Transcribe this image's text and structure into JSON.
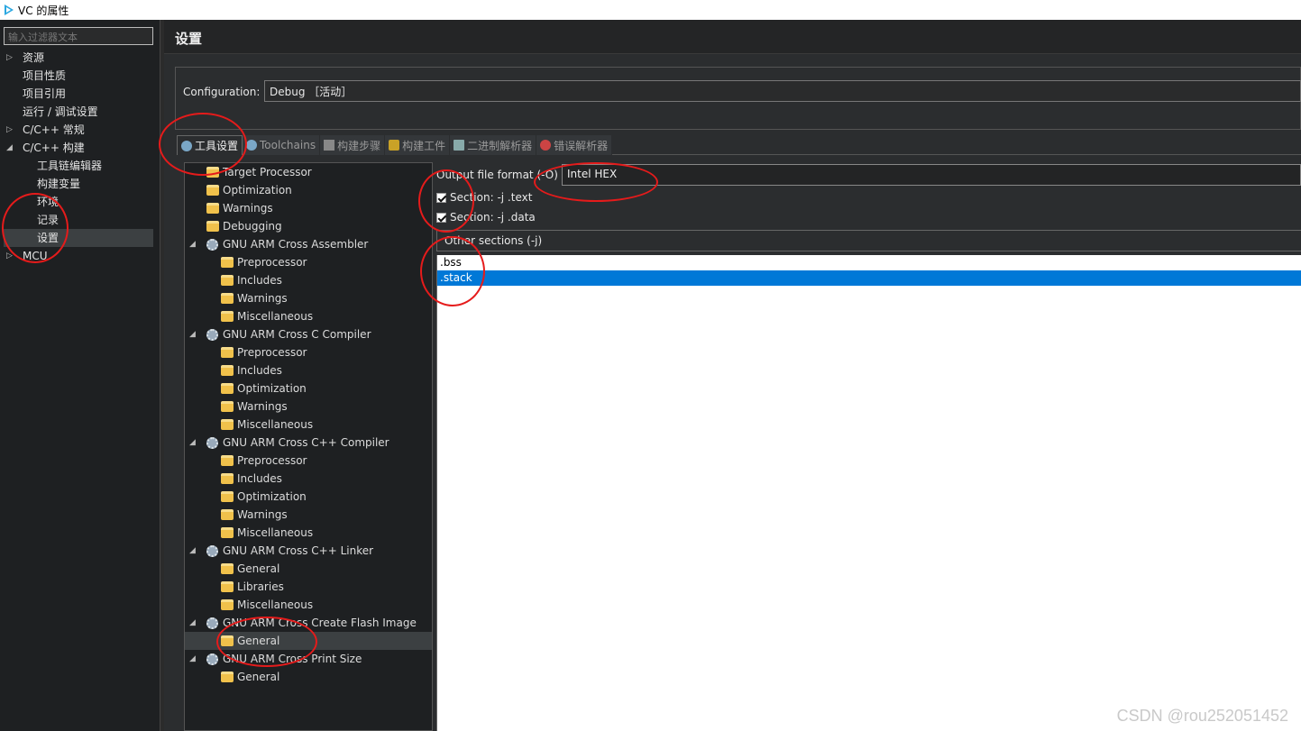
{
  "window": {
    "title": "VC 的属性"
  },
  "filter": {
    "placeholder": "输入过滤器文本"
  },
  "nav": [
    {
      "label": "资源",
      "expand": "▷"
    },
    {
      "label": "项目性质",
      "expand": ""
    },
    {
      "label": "项目引用",
      "expand": ""
    },
    {
      "label": "运行 / 调试设置",
      "expand": ""
    },
    {
      "label": "C/C++ 常规",
      "expand": "▷"
    },
    {
      "label": "C/C++ 构建",
      "expand": "◢"
    },
    {
      "label": "工具链编辑器",
      "expand": ""
    },
    {
      "label": "构建变量",
      "expand": ""
    },
    {
      "label": "环境",
      "expand": ""
    },
    {
      "label": "记录",
      "expand": ""
    },
    {
      "label": "设置",
      "expand": ""
    },
    {
      "label": "MCU",
      "expand": "▷"
    }
  ],
  "page": {
    "title": "设置"
  },
  "config": {
    "label": "Configuration:",
    "value": "Debug ［活动］"
  },
  "tabs": [
    {
      "label": "工具设置",
      "icon": "gear-icon"
    },
    {
      "label": "Toolchains",
      "icon": "gear-icon"
    },
    {
      "label": "构建步骤",
      "icon": "hammer-icon"
    },
    {
      "label": "构建工件",
      "icon": "trophy-icon"
    },
    {
      "label": "二进制解析器",
      "icon": "disk-icon"
    },
    {
      "label": "错误解析器",
      "icon": "bug-icon"
    }
  ],
  "tree": [
    {
      "label": "Target Processor",
      "tri": ""
    },
    {
      "label": "Optimization",
      "tri": ""
    },
    {
      "label": "Warnings",
      "tri": ""
    },
    {
      "label": "Debugging",
      "tri": ""
    },
    {
      "label": "GNU ARM Cross Assembler",
      "tri": "◢"
    },
    {
      "label": "Preprocessor",
      "tri": ""
    },
    {
      "label": "Includes",
      "tri": ""
    },
    {
      "label": "Warnings",
      "tri": ""
    },
    {
      "label": "Miscellaneous",
      "tri": ""
    },
    {
      "label": "GNU ARM Cross C Compiler",
      "tri": "◢"
    },
    {
      "label": "Preprocessor",
      "tri": ""
    },
    {
      "label": "Includes",
      "tri": ""
    },
    {
      "label": "Optimization",
      "tri": ""
    },
    {
      "label": "Warnings",
      "tri": ""
    },
    {
      "label": "Miscellaneous",
      "tri": ""
    },
    {
      "label": "GNU ARM Cross C++ Compiler",
      "tri": "◢"
    },
    {
      "label": "Preprocessor",
      "tri": ""
    },
    {
      "label": "Includes",
      "tri": ""
    },
    {
      "label": "Optimization",
      "tri": ""
    },
    {
      "label": "Warnings",
      "tri": ""
    },
    {
      "label": "Miscellaneous",
      "tri": ""
    },
    {
      "label": "GNU ARM Cross C++ Linker",
      "tri": "◢"
    },
    {
      "label": "General",
      "tri": ""
    },
    {
      "label": "Libraries",
      "tri": ""
    },
    {
      "label": "Miscellaneous",
      "tri": ""
    },
    {
      "label": "GNU ARM Cross Create Flash Image",
      "tri": "◢"
    },
    {
      "label": "General",
      "tri": ""
    },
    {
      "label": "GNU ARM Cross Print Size",
      "tri": "◢"
    },
    {
      "label": "General",
      "tri": ""
    }
  ],
  "options": {
    "format_label": "Output file format (-O)",
    "format_value": "Intel HEX",
    "section_text": "Section: -j .text",
    "section_data": "Section: -j .data",
    "other_sections": "Other sections (-j)",
    "other_items": [
      ".bss",
      ".stack"
    ]
  },
  "watermark": "CSDN @rou252051452",
  "colors": {
    "selection": "#0078d7",
    "annotation": "#e51b1b"
  }
}
